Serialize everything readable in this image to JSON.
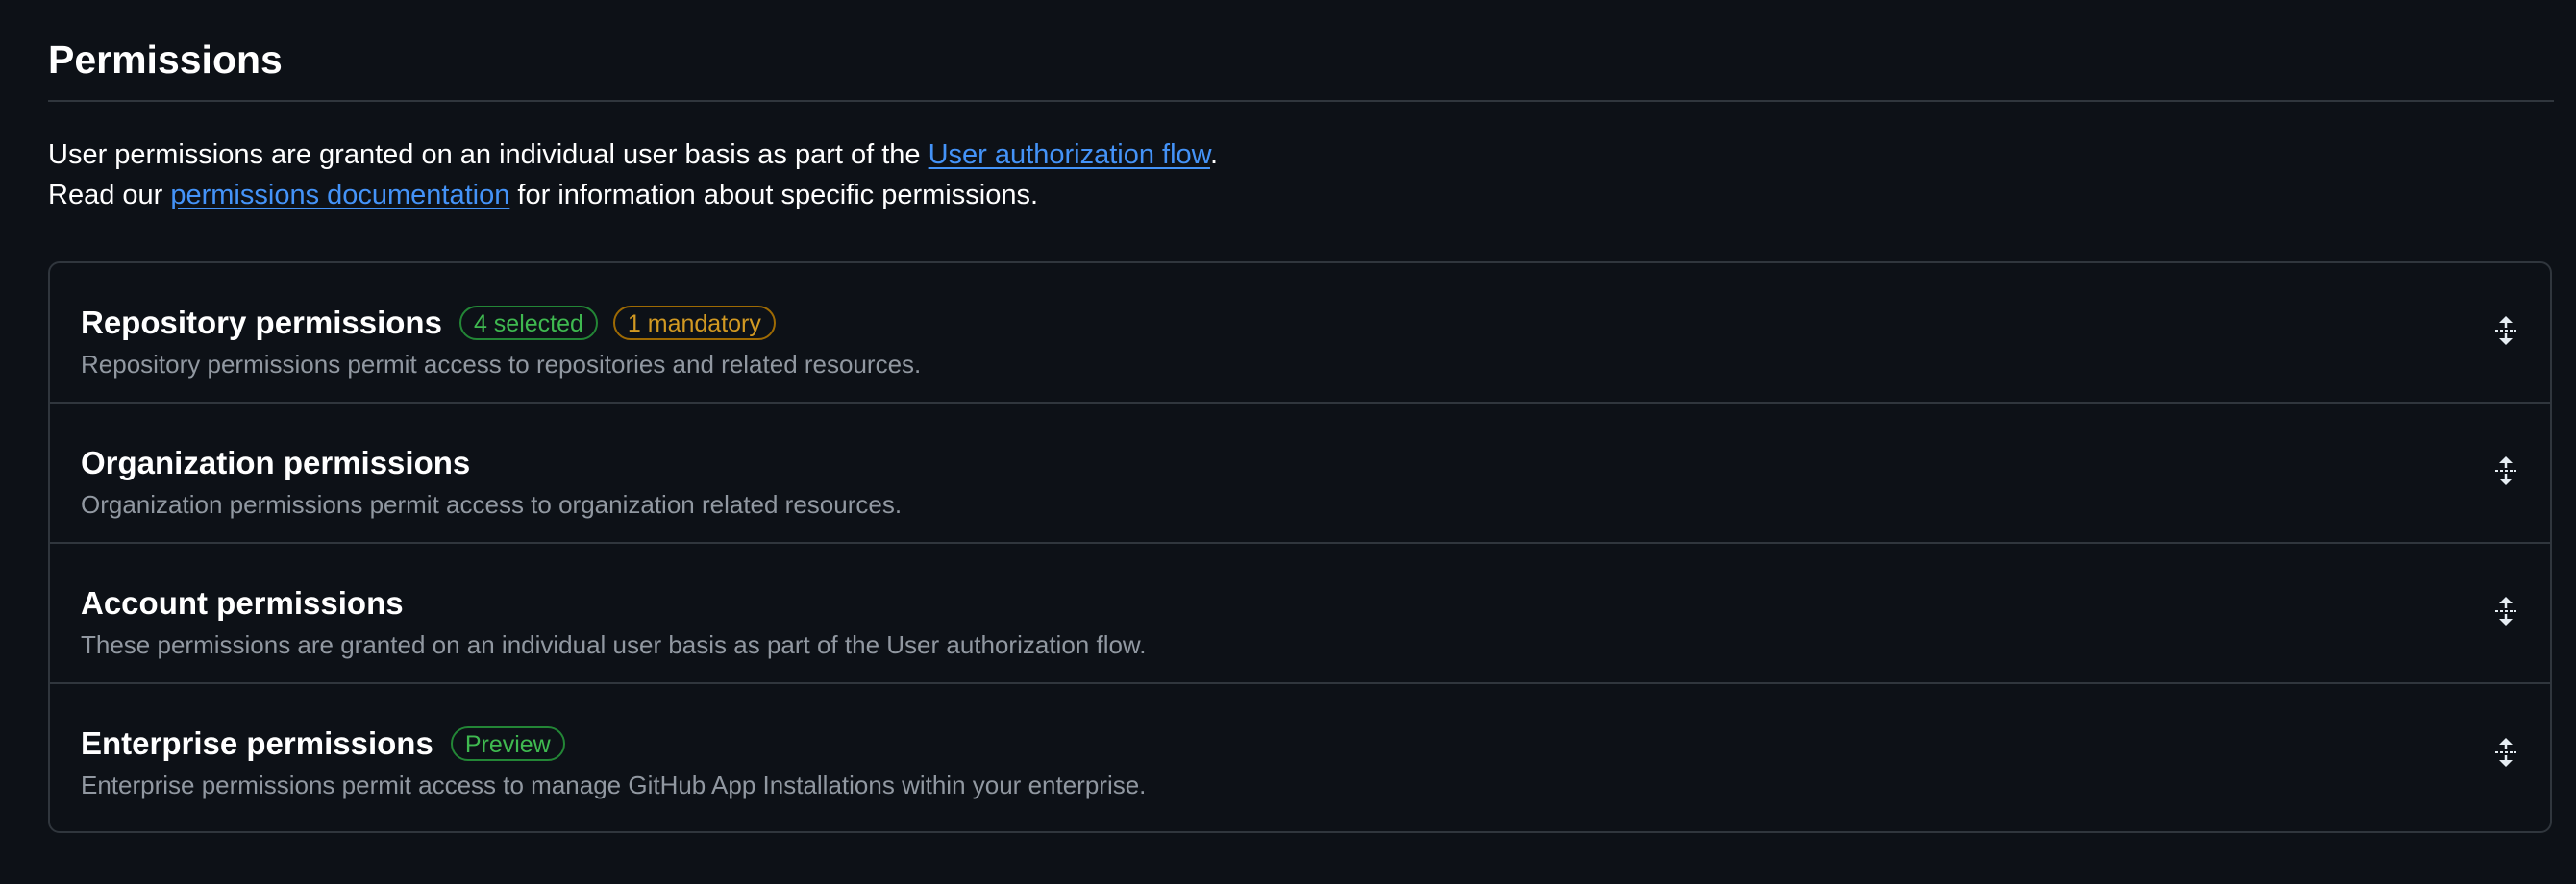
{
  "header": {
    "title": "Permissions"
  },
  "intro": {
    "line1_prefix": "User permissions are granted on an individual user basis as part of the ",
    "line1_link": "User authorization flow",
    "line1_suffix": ".",
    "line2_prefix": "Read our ",
    "line2_link": "permissions documentation",
    "line2_suffix": " for information about specific permissions."
  },
  "sections": [
    {
      "title": "Repository permissions",
      "badges": [
        {
          "label": "4 selected",
          "tone": "green"
        },
        {
          "label": "1 mandatory",
          "tone": "orange"
        }
      ],
      "description": "Repository permissions permit access to repositories and related resources.",
      "icon": "unfold-icon"
    },
    {
      "title": "Organization permissions",
      "badges": [],
      "description": "Organization permissions permit access to organization related resources.",
      "icon": "unfold-icon"
    },
    {
      "title": "Account permissions",
      "badges": [],
      "description": "These permissions are granted on an individual user basis as part of the User authorization flow.",
      "icon": "unfold-icon"
    },
    {
      "title": "Enterprise permissions",
      "badges": [
        {
          "label": "Preview",
          "tone": "green"
        }
      ],
      "description": "Enterprise permissions permit access to manage GitHub App Installations within your enterprise.",
      "icon": "unfold-icon"
    }
  ],
  "colors": {
    "background": "#0d1117",
    "border": "#30363d",
    "link": "#4493f8",
    "badge_green": "#3fb950",
    "badge_orange": "#d29922",
    "muted_text": "#9198a1"
  }
}
